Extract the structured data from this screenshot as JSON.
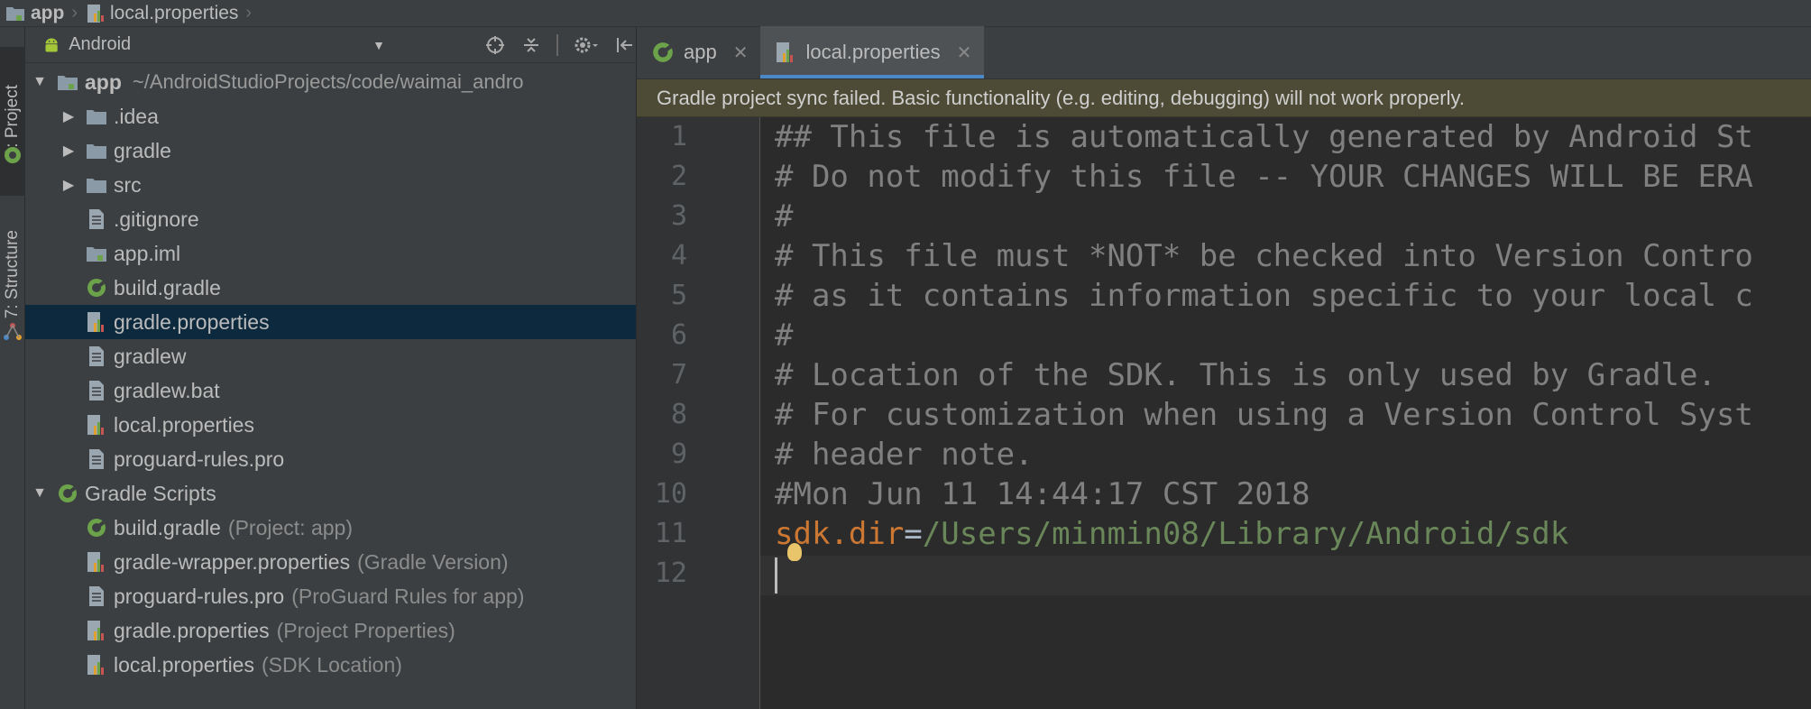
{
  "breadcrumb": [
    {
      "label": "app",
      "icon": "module-folder-icon"
    },
    {
      "label": "local.properties",
      "icon": "properties-file-icon"
    }
  ],
  "toolstrip": {
    "project_tab": "1: Project",
    "structure_tab": "7: Structure"
  },
  "project_panel": {
    "view_mode": "Android",
    "tree": [
      {
        "label": "app",
        "path": "~/AndroidStudioProjects/code/waimai_andro",
        "icon": "module-folder-icon",
        "expanded": true
      },
      {
        "label": ".idea",
        "icon": "folder-icon"
      },
      {
        "label": "gradle",
        "icon": "folder-icon"
      },
      {
        "label": "src",
        "icon": "folder-icon"
      },
      {
        "label": ".gitignore",
        "icon": "text-file-icon"
      },
      {
        "label": "app.iml",
        "icon": "iml-file-icon"
      },
      {
        "label": "build.gradle",
        "icon": "gradle-icon"
      },
      {
        "label": "gradle.properties",
        "icon": "properties-file-icon",
        "selected": true
      },
      {
        "label": "gradlew",
        "icon": "text-file-icon"
      },
      {
        "label": "gradlew.bat",
        "icon": "text-file-icon"
      },
      {
        "label": "local.properties",
        "icon": "properties-file-icon"
      },
      {
        "label": "proguard-rules.pro",
        "icon": "text-file-icon"
      },
      {
        "label": "Gradle Scripts",
        "icon": "gradle-icon",
        "expanded": true
      },
      {
        "label": "build.gradle",
        "hint": "(Project: app)",
        "icon": "gradle-icon"
      },
      {
        "label": "gradle-wrapper.properties",
        "hint": "(Gradle Version)",
        "icon": "properties-file-icon"
      },
      {
        "label": "proguard-rules.pro",
        "hint": "(ProGuard Rules for app)",
        "icon": "text-file-icon"
      },
      {
        "label": "gradle.properties",
        "hint": "(Project Properties)",
        "icon": "properties-file-icon"
      },
      {
        "label": "local.properties",
        "hint": "(SDK Location)",
        "icon": "properties-file-icon"
      }
    ]
  },
  "editor": {
    "tabs": [
      {
        "label": "app",
        "icon": "gradle-icon",
        "active": false
      },
      {
        "label": "local.properties",
        "icon": "properties-file-icon",
        "active": true
      }
    ],
    "banner": "Gradle project sync failed. Basic functionality (e.g. editing, debugging) will not work properly.",
    "line_numbers": [
      "1",
      "2",
      "3",
      "4",
      "5",
      "6",
      "7",
      "8",
      "9",
      "10",
      "11",
      "12"
    ],
    "lines": [
      "## This file is automatically generated by Android St",
      "# Do not modify this file -- YOUR CHANGES WILL BE ERA",
      "#",
      "# This file must *NOT* be checked into Version Contro",
      "# as it contains information specific to your local c",
      "#",
      "# Location of the SDK. This is only used by Gradle.",
      "# For customization when using a Version Control Syst",
      "# header note.",
      "#Mon Jun 11 14:44:17 CST 2018"
    ],
    "sdk_key": "sdk.dir",
    "sdk_eq": "=",
    "sdk_value": "/Users/minmin08/Library/Android/sdk"
  },
  "colors": {
    "panel_bg": "#3c3f41",
    "editor_bg": "#2b2b2b",
    "selection": "#0d293e",
    "banner_bg": "#4d4a35",
    "comment": "#808080",
    "key": "#cc7832",
    "value": "#6a8759",
    "accent": "#4a88c7"
  }
}
